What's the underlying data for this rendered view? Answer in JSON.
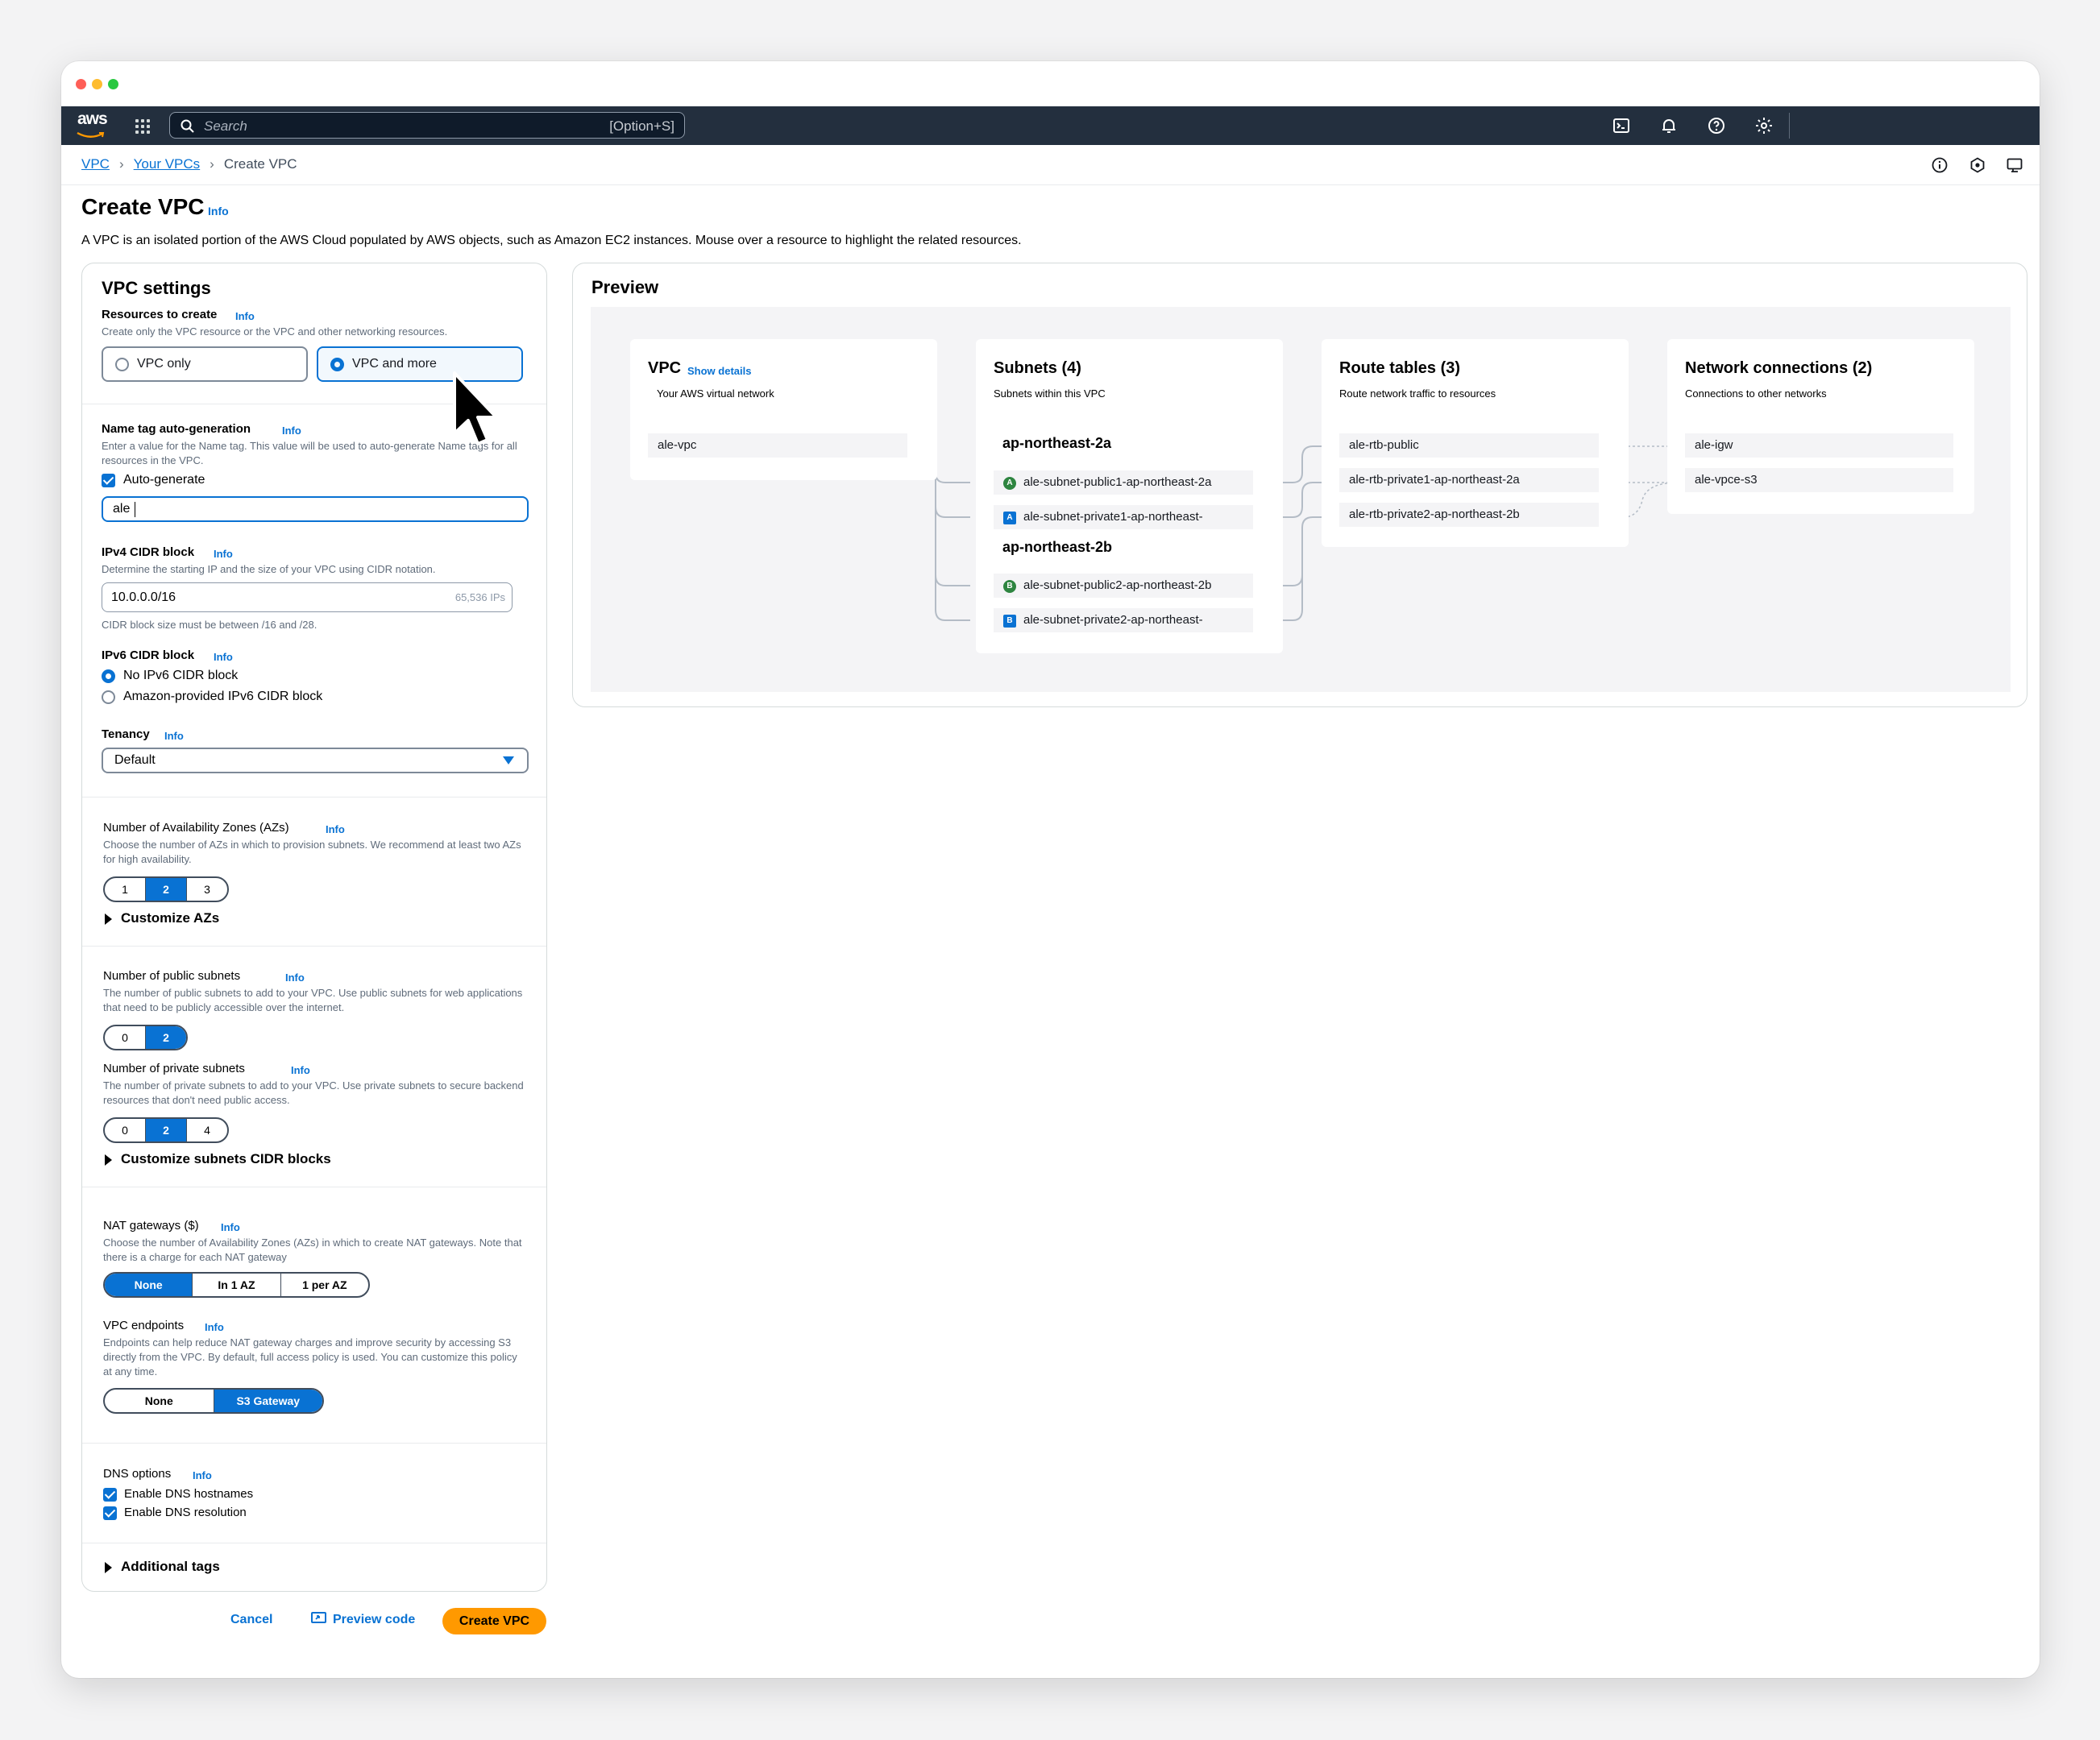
{
  "window": {
    "controls": [
      "close",
      "minimize",
      "zoom"
    ]
  },
  "nav": {
    "logo": "aws",
    "search_placeholder": "Search",
    "search_shortcut": "[Option+S]",
    "icons": [
      "cloudshell-icon",
      "bell-icon",
      "help-icon",
      "gear-icon"
    ]
  },
  "breadcrumb": {
    "items": [
      "VPC",
      "Your VPCs"
    ],
    "current": "Create VPC"
  },
  "page": {
    "title": "Create VPC",
    "info": "Info",
    "description": "A VPC is an isolated portion of the AWS Cloud populated by AWS objects, such as Amazon EC2 instances. Mouse over a resource to highlight the related resources."
  },
  "settings": {
    "heading": "VPC settings",
    "resources": {
      "label": "Resources to create",
      "info": "Info",
      "hint": "Create only the VPC resource or the VPC and other networking resources.",
      "options": [
        "VPC only",
        "VPC and more"
      ],
      "selected": "VPC and more"
    },
    "name_tag": {
      "label": "Name tag auto-generation",
      "info": "Info",
      "hint": "Enter a value for the Name tag. This value will be used to auto-generate Name tags for all resources in the VPC.",
      "checkbox": "Auto-generate",
      "value": "ale"
    },
    "ipv4": {
      "label": "IPv4 CIDR block",
      "info": "Info",
      "hint": "Determine the starting IP and the size of your VPC using CIDR notation.",
      "value": "10.0.0.0/16",
      "suffix": "65,536 IPs",
      "constraint": "CIDR block size must be between /16 and /28."
    },
    "ipv6": {
      "label": "IPv6 CIDR block",
      "info": "Info",
      "options": [
        "No IPv6 CIDR block",
        "Amazon-provided IPv6 CIDR block"
      ],
      "selected": "No IPv6 CIDR block"
    },
    "tenancy": {
      "label": "Tenancy",
      "info": "Info",
      "value": "Default"
    },
    "azs": {
      "label": "Number of Availability Zones (AZs)",
      "info": "Info",
      "hint": "Choose the number of AZs in which to provision subnets. We recommend at least two AZs for high availability.",
      "options": [
        "1",
        "2",
        "3"
      ],
      "selected": "2",
      "customize": "Customize AZs"
    },
    "public_subnets": {
      "label": "Number of public subnets",
      "info": "Info",
      "hint": "The number of public subnets to add to your VPC. Use public subnets for web applications that need to be publicly accessible over the internet.",
      "options": [
        "0",
        "2"
      ],
      "selected": "2"
    },
    "private_subnets": {
      "label": "Number of private subnets",
      "info": "Info",
      "hint": "The number of private subnets to add to your VPC. Use private subnets to secure backend resources that don't need public access.",
      "options": [
        "0",
        "2",
        "4"
      ],
      "selected": "2",
      "customize": "Customize subnets CIDR blocks"
    },
    "nat": {
      "label": "NAT gateways ($)",
      "info": "Info",
      "hint": "Choose the number of Availability Zones (AZs) in which to create NAT gateways. Note that there is a charge for each NAT gateway",
      "options": [
        "None",
        "In 1 AZ",
        "1 per AZ"
      ],
      "selected": "None"
    },
    "endpoints": {
      "label": "VPC endpoints",
      "info": "Info",
      "hint": "Endpoints can help reduce NAT gateway charges and improve security by accessing S3 directly from the VPC. By default, full access policy is used. You can customize this policy at any time.",
      "options": [
        "None",
        "S3 Gateway"
      ],
      "selected": "S3 Gateway"
    },
    "dns": {
      "label": "DNS options",
      "info": "Info",
      "options": [
        "Enable DNS hostnames",
        "Enable DNS resolution"
      ]
    },
    "additional_tags": "Additional tags"
  },
  "actions": {
    "cancel": "Cancel",
    "preview_code": "Preview code",
    "create": "Create VPC"
  },
  "preview": {
    "heading": "Preview",
    "vpc": {
      "title": "VPC",
      "link": "Show details",
      "subtitle": "Your AWS virtual network",
      "name": "ale-vpc"
    },
    "subnets": {
      "title": "Subnets (4)",
      "subtitle": "Subnets within this VPC",
      "az1": "ap-northeast-2a",
      "az2": "ap-northeast-2b",
      "items": [
        {
          "badge": "A",
          "kind": "public",
          "name": "ale-subnet-public1-ap-northeast-2a"
        },
        {
          "badge": "A",
          "kind": "private",
          "name": "ale-subnet-private1-ap-northeast-"
        },
        {
          "badge": "B",
          "kind": "public",
          "name": "ale-subnet-public2-ap-northeast-2b"
        },
        {
          "badge": "B",
          "kind": "private",
          "name": "ale-subnet-private2-ap-northeast-"
        }
      ]
    },
    "route_tables": {
      "title": "Route tables (3)",
      "subtitle": "Route network traffic to resources",
      "items": [
        "ale-rtb-public",
        "ale-rtb-private1-ap-northeast-2a",
        "ale-rtb-private2-ap-northeast-2b"
      ]
    },
    "network": {
      "title": "Network connections (2)",
      "subtitle": "Connections to other networks",
      "items": [
        "ale-igw",
        "ale-vpce-s3"
      ]
    }
  },
  "colors": {
    "nav": "#232f3e",
    "accent": "#0972d3",
    "primary_button": "#ff9900",
    "public_badge": "#2e8540"
  }
}
